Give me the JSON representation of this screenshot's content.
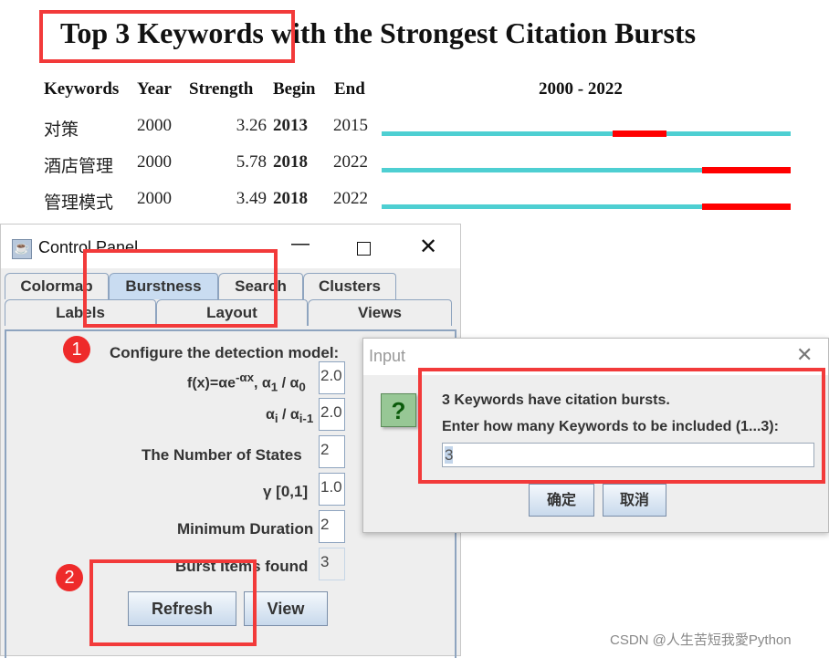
{
  "figure": {
    "title": "Top 3 Keywords with the Strongest Citation Bursts",
    "headers": [
      "Keywords",
      "Year",
      "Strength",
      "Begin",
      "End",
      "2000 - 2022"
    ],
    "range": [
      2000,
      2022
    ],
    "rows": [
      {
        "keyword": "对策",
        "year": "2000",
        "strength": "3.26",
        "begin": "2013",
        "end": "2015"
      },
      {
        "keyword": "酒店管理",
        "year": "2000",
        "strength": "5.78",
        "begin": "2018",
        "end": "2022"
      },
      {
        "keyword": "管理模式",
        "year": "2000",
        "strength": "3.49",
        "begin": "2018",
        "end": "2022"
      }
    ],
    "colors": {
      "timeline": "#4ecfd2",
      "burst": "#ff0000",
      "highlight": "#f23a3a"
    }
  },
  "control_panel": {
    "title": "Control Panel",
    "tabs_row1": [
      "Colormap",
      "Burstness",
      "Search",
      "Clusters"
    ],
    "tabs_row2": [
      "Labels",
      "Layout",
      "Views"
    ],
    "selected_tab": "Burstness",
    "heading": "Configure the detection model:",
    "fields": {
      "alpha_ratio": "2.0",
      "alpha_i_ratio": "2.0",
      "states_label": "The Number of States",
      "states": "2",
      "gamma_label": "γ [0,1]",
      "gamma": "1.0",
      "min_dur_label": "Minimum Duration",
      "min_dur": "2",
      "found_label": "Burst Items found",
      "found": "3"
    },
    "refresh": "Refresh",
    "view": "View"
  },
  "badges": [
    "1",
    "2"
  ],
  "dialog": {
    "title": "Input",
    "line1": "3 Keywords have citation bursts.",
    "line2": "Enter how many Keywords to be included (1...3):",
    "value": "3",
    "ok": "确定",
    "cancel": "取消",
    "icon": "question-icon"
  },
  "watermark": "CSDN @人生苦短我愛Python"
}
